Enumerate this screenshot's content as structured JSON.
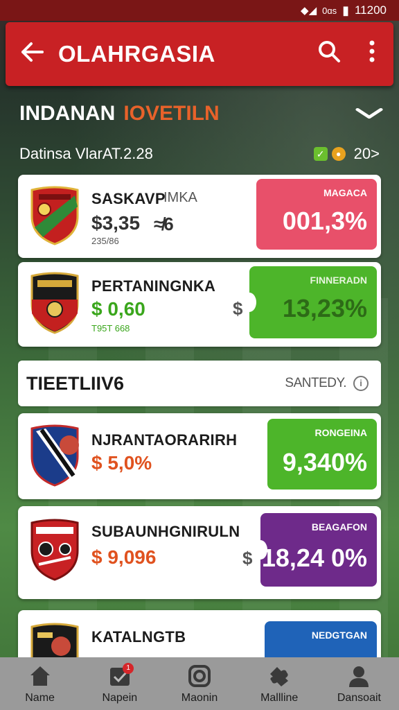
{
  "status_bar": {
    "time": "11200",
    "carrier": "0ɑs"
  },
  "app_bar": {
    "title": "OLAHRGASIA",
    "back_icon": "arrow-left-icon",
    "search_icon": "search-icon",
    "more_icon": "more-vertical-icon"
  },
  "section": {
    "title_part1": "INDANAN",
    "title_part2": "IOVETILN",
    "date_label": "Datinsa VlarAT.2.28",
    "count": "20>"
  },
  "cards": [
    {
      "name": "SASKAVP",
      "tag": "IMKA",
      "price": "$3,35",
      "price_extra": "≉6",
      "sub": "235/86",
      "pill_label": "MAGACA",
      "pill_value": "001,3%",
      "pill_color": "#e8506a",
      "price_color": "#333333"
    },
    {
      "name": "PERTANINGNKA",
      "price": "$ 0,60",
      "sub": "T95T 668",
      "dollar": "$",
      "pill_label": "FINNERADN",
      "pill_value": "13,23%",
      "pill_color": "#4db52a",
      "price_color": "#3aa61c"
    }
  ],
  "section2": {
    "title": "TIEETLIIV6",
    "right_label": "SANTEDY.",
    "info_icon": "info-icon"
  },
  "cards2": [
    {
      "name": "NJRANTAORARIRH",
      "price": "$ 5,0%",
      "pill_label": "RONGEINA",
      "pill_value": "9,340%",
      "pill_color": "#4db52a",
      "price_color": "#e0521f"
    },
    {
      "name": "SUBAUNHGNIRULN",
      "price": "$ 9,096",
      "dollar": "$",
      "pill_label": "BEAGAFON",
      "pill_value": "18,24 0%",
      "pill_color": "#6e2a8a",
      "price_color": "#e0521f"
    },
    {
      "name": "KATALNGTB",
      "price": "",
      "pill_label": "NEDGTGAN",
      "pill_value": "",
      "pill_color": "#1f63b8",
      "price_color": "#e0521f"
    }
  ],
  "bottom_nav": [
    {
      "label": "Name",
      "icon": "home-icon"
    },
    {
      "label": "Napein",
      "icon": "calendar-check-icon",
      "badge": "1"
    },
    {
      "label": "Maonin",
      "icon": "camera-icon"
    },
    {
      "label": "Mallline",
      "icon": "puzzle-icon"
    },
    {
      "label": "Dansoait",
      "icon": "profile-icon"
    }
  ]
}
